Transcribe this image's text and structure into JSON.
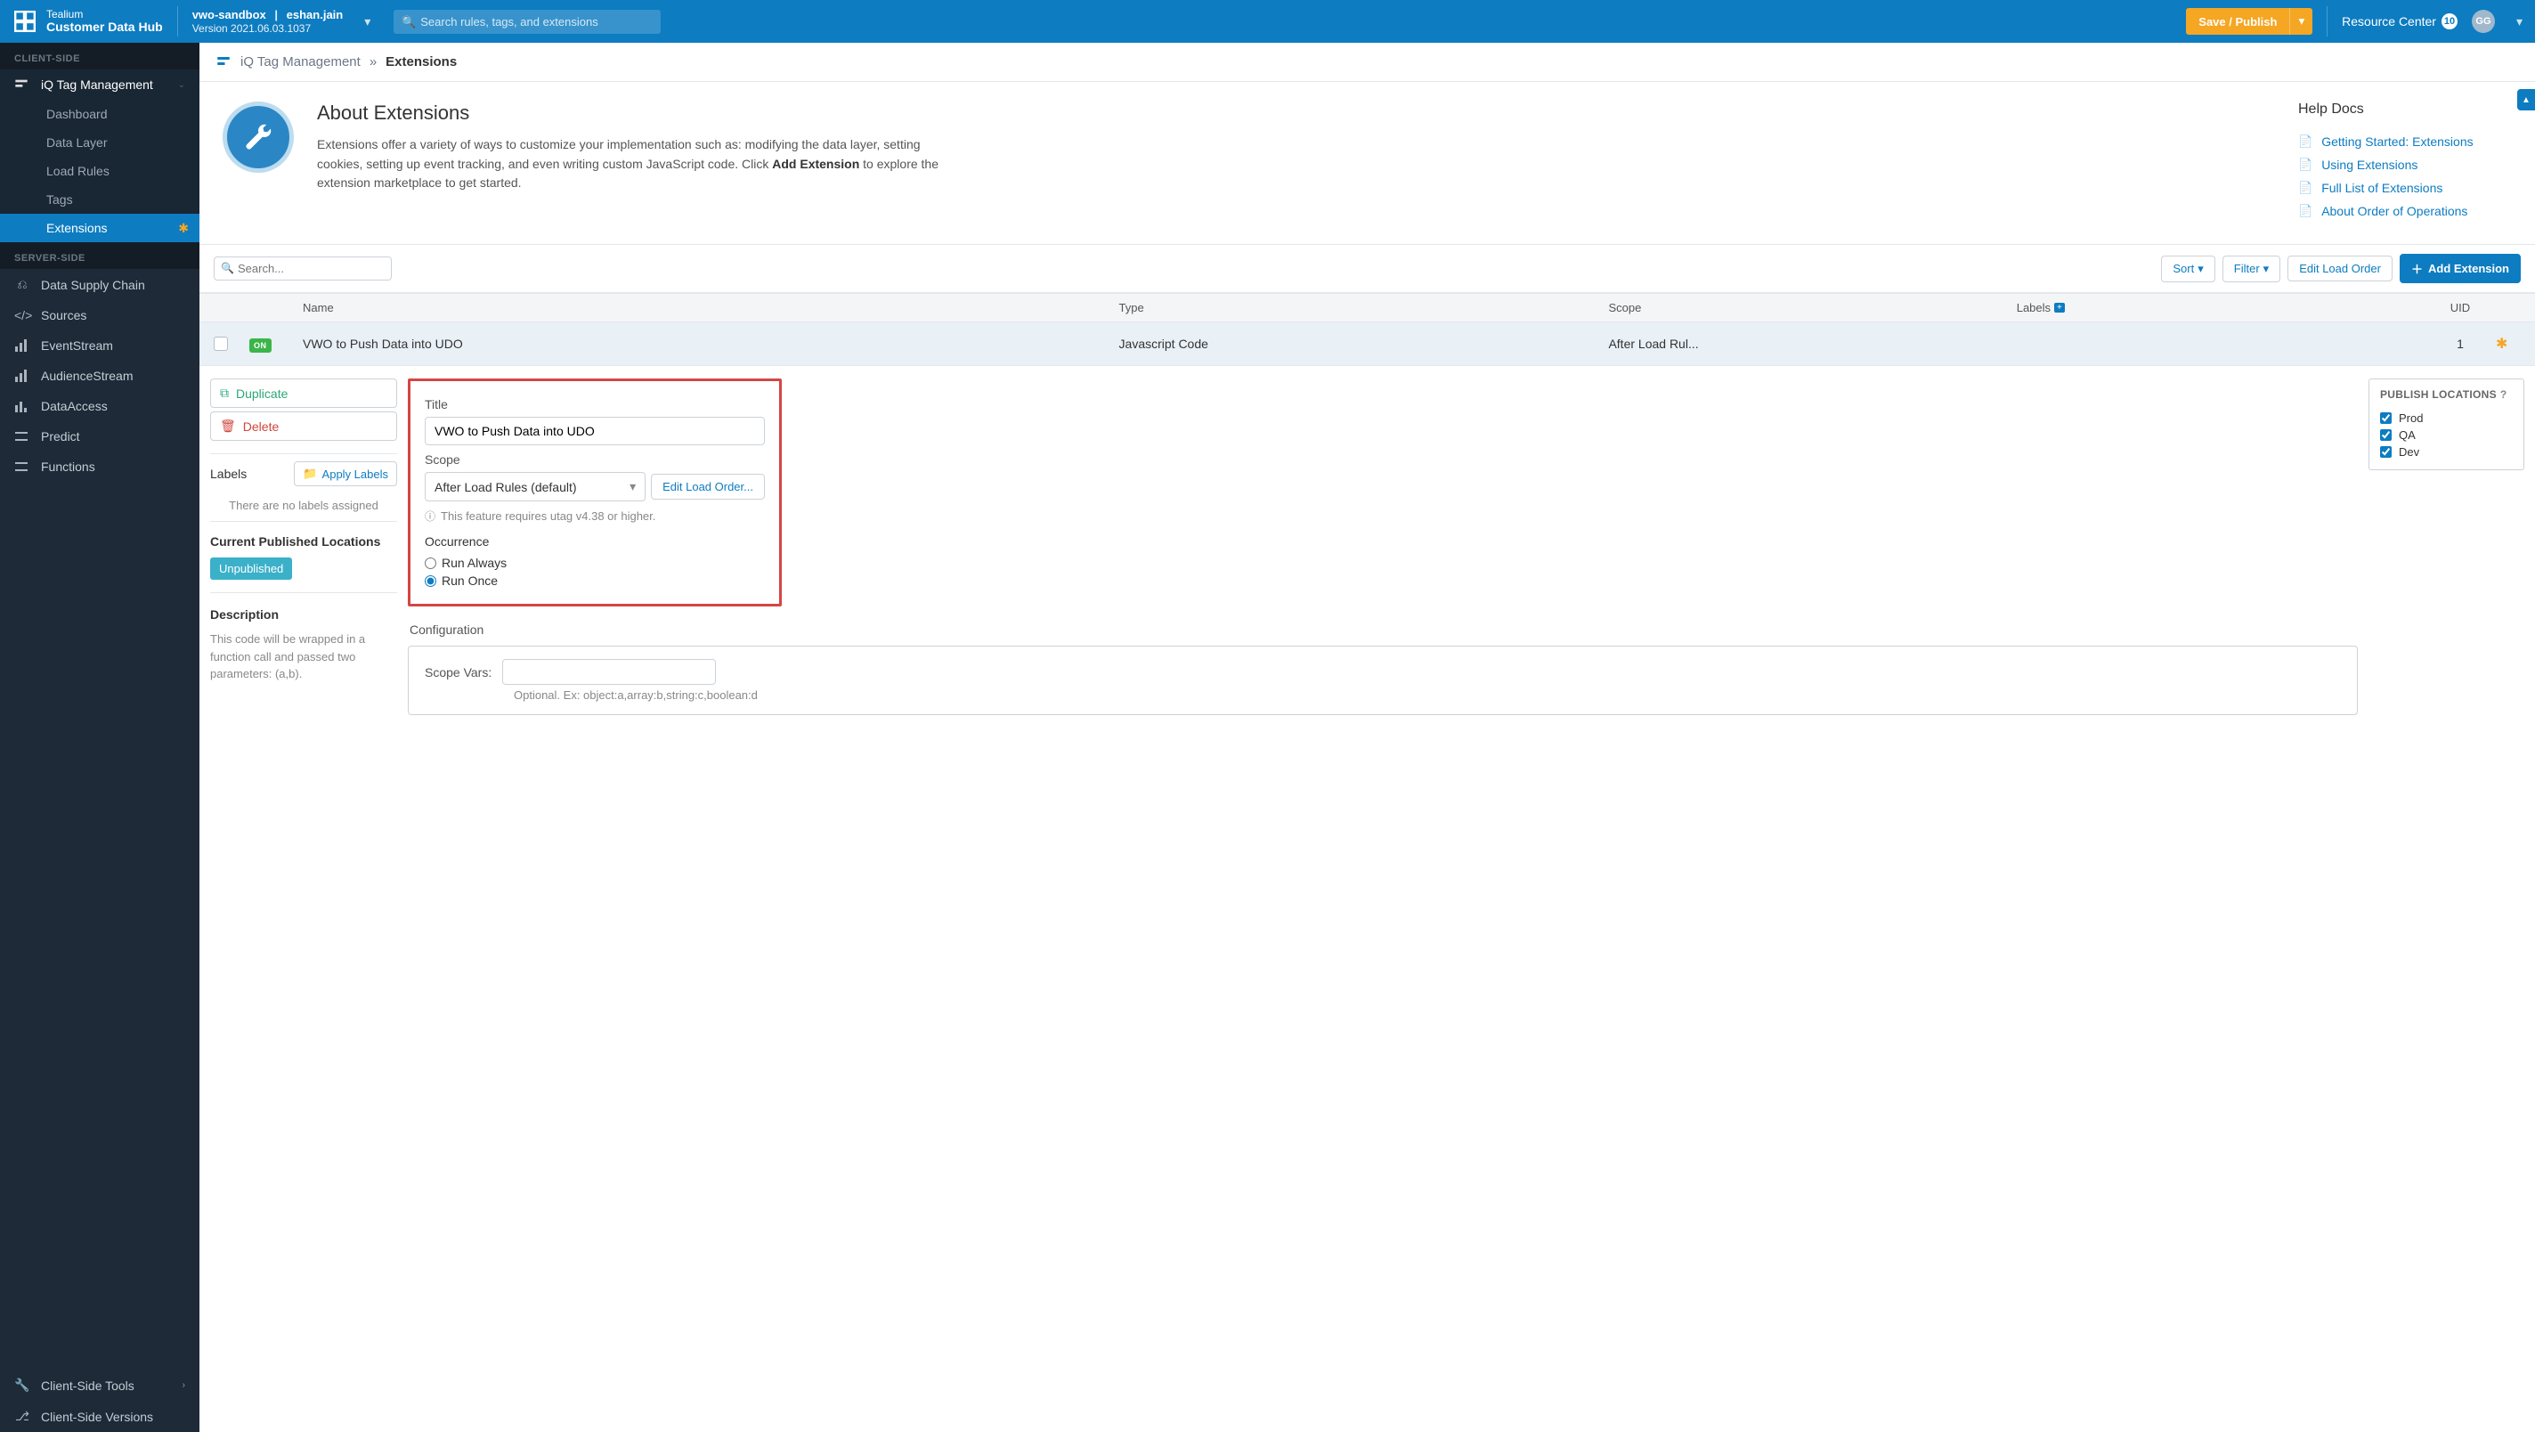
{
  "header": {
    "brand_top": "Tealium",
    "brand_bottom": "Customer Data Hub",
    "profile_account": "vwo-sandbox",
    "profile_user": "eshan.jain",
    "version": "Version 2021.06.03.1037",
    "search_placeholder": "Search rules, tags, and extensions",
    "save_publish": "Save / Publish",
    "resource_center": "Resource Center",
    "rc_count": "10",
    "avatar_initials": "GG"
  },
  "sidebar": {
    "section_client": "CLIENT-SIDE",
    "iq_label": "iQ Tag Management",
    "sub": {
      "dashboard": "Dashboard",
      "data_layer": "Data Layer",
      "load_rules": "Load Rules",
      "tags": "Tags",
      "extensions": "Extensions"
    },
    "section_server": "SERVER-SIDE",
    "data_supply": "Data Supply Chain",
    "sources": "Sources",
    "event_stream": "EventStream",
    "audience_stream": "AudienceStream",
    "data_access": "DataAccess",
    "predict": "Predict",
    "functions": "Functions",
    "client_tools": "Client-Side Tools",
    "client_versions": "Client-Side Versions"
  },
  "breadcrumb": {
    "parent": "iQ Tag Management",
    "current": "Extensions"
  },
  "about": {
    "title": "About Extensions",
    "desc_1": "Extensions offer a variety of ways to customize your implementation such as: modifying the data layer, setting cookies, setting up event tracking, and even writing custom JavaScript code. Click ",
    "desc_bold": "Add Extension",
    "desc_2": " to explore the extension marketplace to get started.",
    "help_title": "Help Docs",
    "help_links": {
      "l1": "Getting Started: Extensions",
      "l2": "Using Extensions",
      "l3": "Full List of Extensions",
      "l4": "About Order of Operations"
    }
  },
  "toolbar": {
    "search_placeholder": "Search...",
    "sort": "Sort",
    "filter": "Filter",
    "edit_load_order": "Edit Load Order",
    "add_extension": "Add Extension"
  },
  "table": {
    "head": {
      "name": "Name",
      "type": "Type",
      "scope": "Scope",
      "labels": "Labels",
      "uid": "UID"
    },
    "row": {
      "status": "ON",
      "name": "VWO to Push Data into UDO",
      "type": "Javascript Code",
      "scope": "After Load Rul...",
      "uid": "1"
    }
  },
  "detail": {
    "duplicate": "Duplicate",
    "delete": "Delete",
    "labels": "Labels",
    "apply_labels": "Apply Labels",
    "no_labels": "There are no labels assigned",
    "pub_heading": "Current Published Locations",
    "unpublished": "Unpublished",
    "description_heading": "Description",
    "description_text": "This code will be wrapped in a function call and passed two parameters: (a,b).",
    "title_label": "Title",
    "title_value": "VWO to Push Data into UDO",
    "scope_label": "Scope",
    "scope_value": "After Load Rules (default)",
    "edit_load_order_ellipsis": "Edit Load Order...",
    "scope_note": "This feature requires utag v4.38 or higher.",
    "occurrence_label": "Occurrence",
    "run_always": "Run Always",
    "run_once": "Run Once",
    "configuration": "Configuration",
    "scope_vars_label": "Scope Vars:",
    "optional_hint": "Optional. Ex: object:a,array:b,string:c,boolean:d",
    "publish_locations": "PUBLISH LOCATIONS",
    "env": {
      "prod": "Prod",
      "qa": "QA",
      "dev": "Dev"
    }
  }
}
